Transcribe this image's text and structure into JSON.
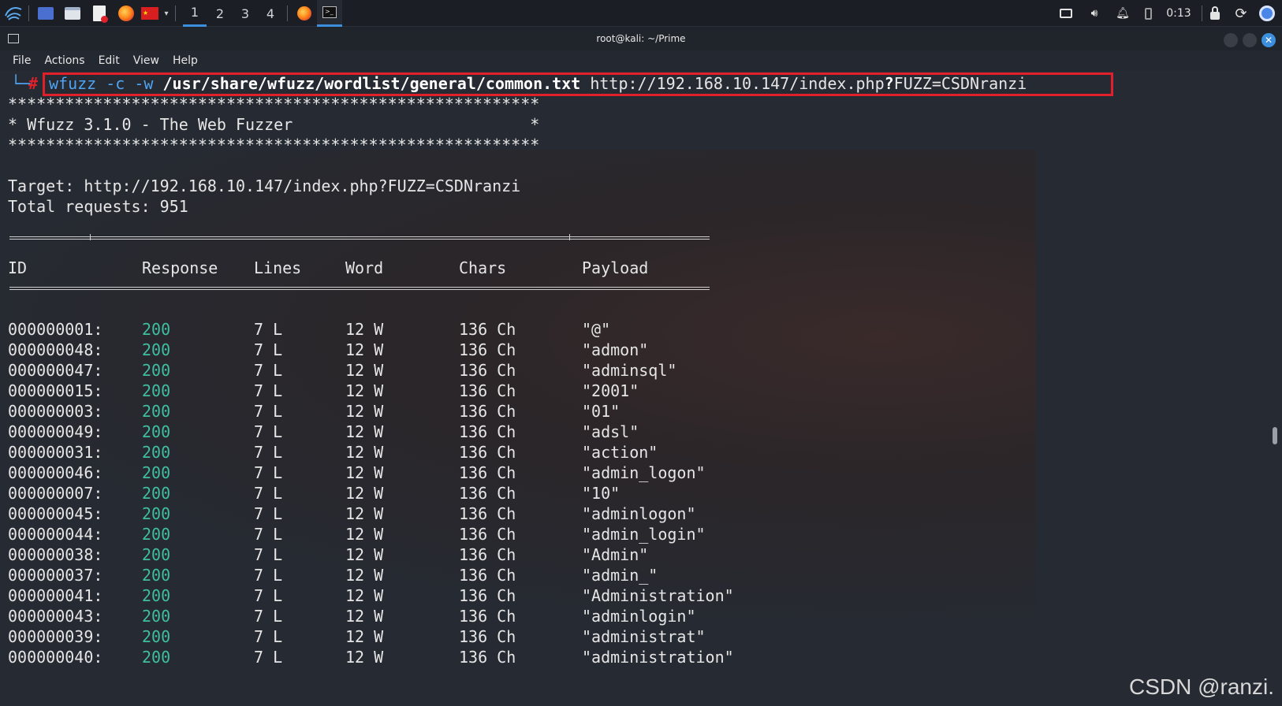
{
  "panel": {
    "workspaces": [
      "1",
      "2",
      "3",
      "4"
    ],
    "active_workspace": "1",
    "clock": "0:13"
  },
  "window": {
    "title": "root@kali: ~/Prime",
    "menu": [
      "File",
      "Actions",
      "Edit",
      "View",
      "Help"
    ]
  },
  "terminal": {
    "prompt_symbol": "#",
    "command": {
      "part1": "wfuzz -c -w ",
      "part2": "/usr/share/wfuzz/wordlist/general/common.txt",
      "part3": " http://192.168.10.147/index.php",
      "part4": "?",
      "part5": "FUZZ=CSDNranzi"
    },
    "banner": {
      "stars": "********************************************************",
      "line": "* Wfuzz 3.1.0 - The Web Fuzzer                         *"
    },
    "target": "Target: http://192.168.10.147/index.php?FUZZ=CSDNranzi",
    "total": "Total requests: 951",
    "headers": {
      "id": "ID",
      "response": "Response",
      "lines": "Lines",
      "word": "Word",
      "chars": "Chars",
      "payload": "Payload"
    },
    "rows": [
      {
        "id": "000000001:",
        "response": "200",
        "lines": "7 L",
        "word": "12 W",
        "chars": "136 Ch",
        "payload": "\"@\""
      },
      {
        "id": "000000048:",
        "response": "200",
        "lines": "7 L",
        "word": "12 W",
        "chars": "136 Ch",
        "payload": "\"admon\""
      },
      {
        "id": "000000047:",
        "response": "200",
        "lines": "7 L",
        "word": "12 W",
        "chars": "136 Ch",
        "payload": "\"adminsql\""
      },
      {
        "id": "000000015:",
        "response": "200",
        "lines": "7 L",
        "word": "12 W",
        "chars": "136 Ch",
        "payload": "\"2001\""
      },
      {
        "id": "000000003:",
        "response": "200",
        "lines": "7 L",
        "word": "12 W",
        "chars": "136 Ch",
        "payload": "\"01\""
      },
      {
        "id": "000000049:",
        "response": "200",
        "lines": "7 L",
        "word": "12 W",
        "chars": "136 Ch",
        "payload": "\"adsl\""
      },
      {
        "id": "000000031:",
        "response": "200",
        "lines": "7 L",
        "word": "12 W",
        "chars": "136 Ch",
        "payload": "\"action\""
      },
      {
        "id": "000000046:",
        "response": "200",
        "lines": "7 L",
        "word": "12 W",
        "chars": "136 Ch",
        "payload": "\"admin_logon\""
      },
      {
        "id": "000000007:",
        "response": "200",
        "lines": "7 L",
        "word": "12 W",
        "chars": "136 Ch",
        "payload": "\"10\""
      },
      {
        "id": "000000045:",
        "response": "200",
        "lines": "7 L",
        "word": "12 W",
        "chars": "136 Ch",
        "payload": "\"adminlogon\""
      },
      {
        "id": "000000044:",
        "response": "200",
        "lines": "7 L",
        "word": "12 W",
        "chars": "136 Ch",
        "payload": "\"admin_login\""
      },
      {
        "id": "000000038:",
        "response": "200",
        "lines": "7 L",
        "word": "12 W",
        "chars": "136 Ch",
        "payload": "\"Admin\""
      },
      {
        "id": "000000037:",
        "response": "200",
        "lines": "7 L",
        "word": "12 W",
        "chars": "136 Ch",
        "payload": "\"admin_\""
      },
      {
        "id": "000000041:",
        "response": "200",
        "lines": "7 L",
        "word": "12 W",
        "chars": "136 Ch",
        "payload": "\"Administration\""
      },
      {
        "id": "000000043:",
        "response": "200",
        "lines": "7 L",
        "word": "12 W",
        "chars": "136 Ch",
        "payload": "\"adminlogin\""
      },
      {
        "id": "000000039:",
        "response": "200",
        "lines": "7 L",
        "word": "12 W",
        "chars": "136 Ch",
        "payload": "\"administrat\""
      },
      {
        "id": "000000040:",
        "response": "200",
        "lines": "7 L",
        "word": "12 W",
        "chars": "136 Ch",
        "payload": "\"administration\""
      }
    ]
  },
  "watermark": "CSDN @ranzi.",
  "colors": {
    "accent_blue": "#4fa3f0",
    "response_green": "#3fbfa0",
    "highlight_red": "#e0202a",
    "prompt_red": "#e0202a"
  }
}
